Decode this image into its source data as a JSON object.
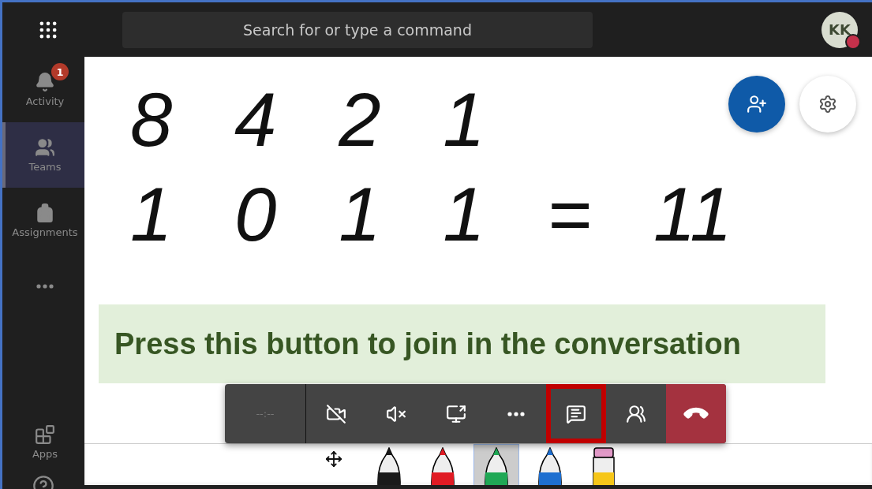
{
  "top_bar": {
    "search_placeholder": "Search for or type a command",
    "avatar": {
      "initials": "KK",
      "color": "#c4314b"
    }
  },
  "sidebar": {
    "items": [
      {
        "label": "Activity",
        "badge": "1",
        "selected": false
      },
      {
        "label": "Teams",
        "selected": true
      },
      {
        "label": "Assignments",
        "selected": false
      }
    ],
    "bottom_items": [
      {
        "label": "Apps"
      }
    ]
  },
  "whiteboard": {
    "lines": [
      "8 4 2 1",
      "1 0 1 1 = 11"
    ]
  },
  "callout": "Press this button to join in the conversation",
  "call_controls": [
    {
      "kind": "timer",
      "text": "--:--",
      "disabled": true
    },
    {
      "kind": "video",
      "highlighted": false
    },
    {
      "kind": "mute",
      "highlighted": false
    },
    {
      "kind": "share",
      "highlighted": false
    },
    {
      "kind": "more",
      "highlighted": false
    },
    {
      "kind": "chat",
      "highlighted": true
    },
    {
      "kind": "people",
      "highlighted": false
    },
    {
      "kind": "hangup",
      "highlighted": false
    }
  ],
  "pens": [
    {
      "kind": "pen",
      "color": "#1a1a1a",
      "selected": false
    },
    {
      "kind": "pen",
      "color": "#e01b24",
      "selected": false
    },
    {
      "kind": "pen",
      "color": "#1fa855",
      "selected": true
    },
    {
      "kind": "pen",
      "color": "#1e6fd0",
      "selected": false
    },
    {
      "kind": "highlighter",
      "color": "#f6c619",
      "selected": false
    }
  ]
}
